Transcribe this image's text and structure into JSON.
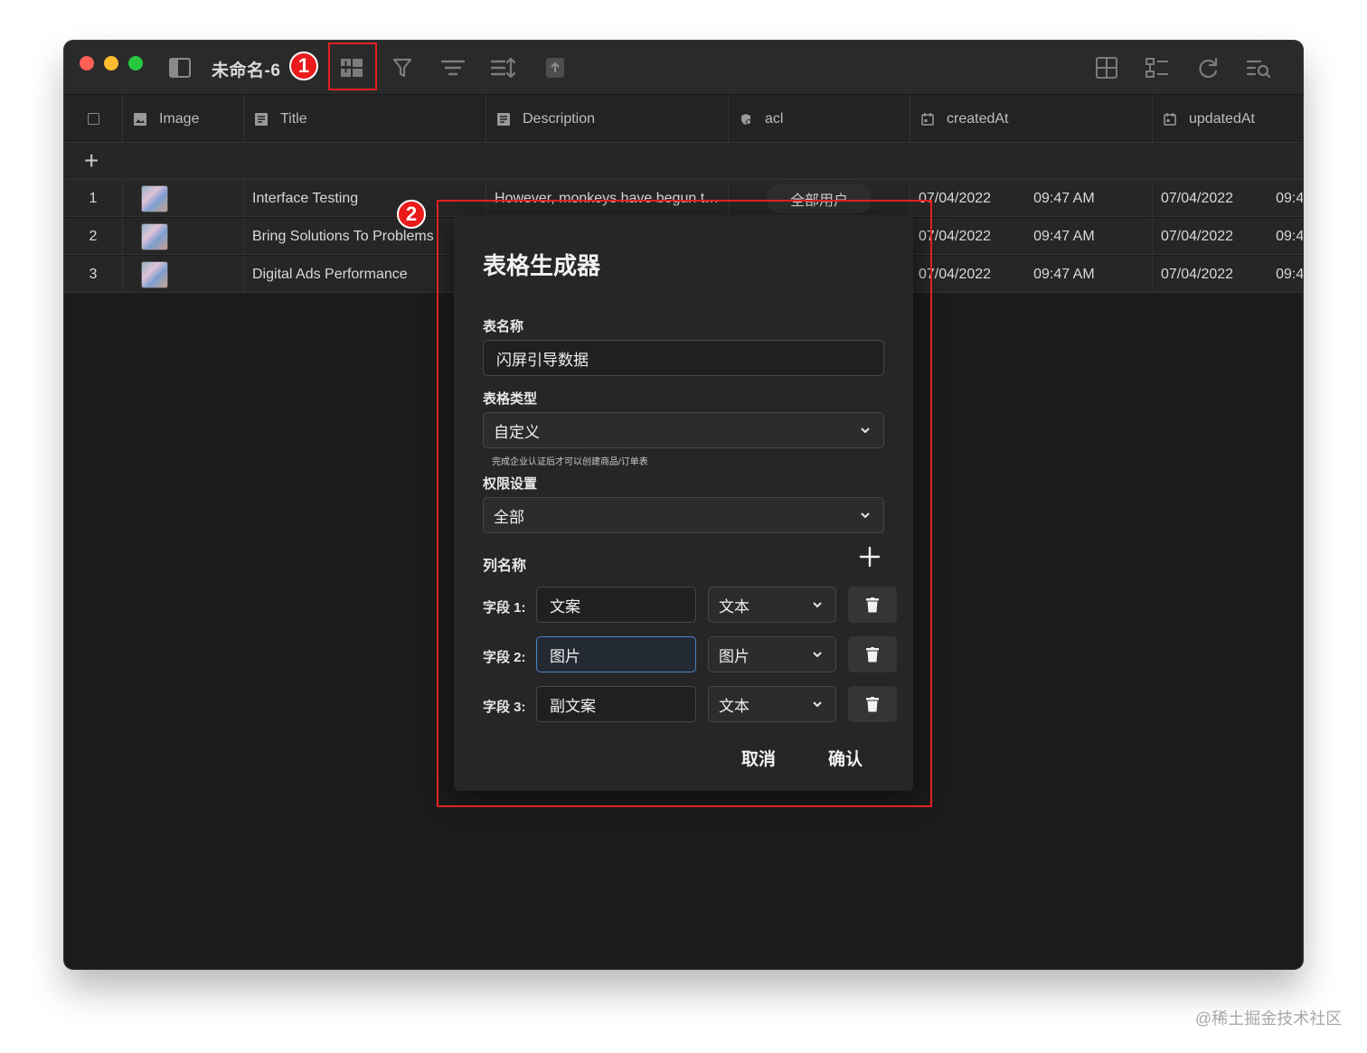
{
  "window": {
    "title": "未命名-6"
  },
  "callouts": {
    "one": "1",
    "two": "2"
  },
  "table": {
    "columns": [
      {
        "label": "Image",
        "icon": "image-icon"
      },
      {
        "label": "Title",
        "icon": "text-field-icon"
      },
      {
        "label": "Description",
        "icon": "text-field-icon"
      },
      {
        "label": "acl",
        "icon": "acl-icon"
      },
      {
        "label": "createdAt",
        "icon": "calendar-icon"
      },
      {
        "label": "updatedAt",
        "icon": "calendar-icon"
      }
    ],
    "add_row_label": "+",
    "rows": [
      {
        "index": "1",
        "title": "Interface Testing",
        "description": "However, monkeys have begun t…",
        "acl": "全部用户",
        "created_date": "07/04/2022",
        "created_time": "09:47 AM",
        "updated_date": "07/04/2022",
        "updated_time": "09:4"
      },
      {
        "index": "2",
        "title": "Bring Solutions To Problems",
        "description": "",
        "acl": "",
        "created_date": "07/04/2022",
        "created_time": "09:47 AM",
        "updated_date": "07/04/2022",
        "updated_time": "09:4"
      },
      {
        "index": "3",
        "title": "Digital Ads Performance",
        "description": "",
        "acl": "",
        "created_date": "07/04/2022",
        "created_time": "09:47 AM",
        "updated_date": "07/04/2022",
        "updated_time": "09:4"
      }
    ]
  },
  "dialog": {
    "title": "表格生成器",
    "table_name_label": "表名称",
    "table_name_value": "闪屏引导数据",
    "table_type_label": "表格类型",
    "table_type_value": "自定义",
    "table_type_hint": "完成企业认证后才可以创建商品/订单表",
    "permission_label": "权限设置",
    "permission_value": "全部",
    "columns_label": "列名称",
    "fields": [
      {
        "label": "字段 1:",
        "value": "文案",
        "type": "文本"
      },
      {
        "label": "字段 2:",
        "value": "图片",
        "type": "图片"
      },
      {
        "label": "字段 3:",
        "value": "副文案",
        "type": "文本"
      }
    ],
    "cancel": "取消",
    "confirm": "确认"
  },
  "watermark": "@稀土掘金技术社区",
  "colors": {
    "accent_red": "#e32020",
    "focus_blue": "#4c86c9"
  }
}
